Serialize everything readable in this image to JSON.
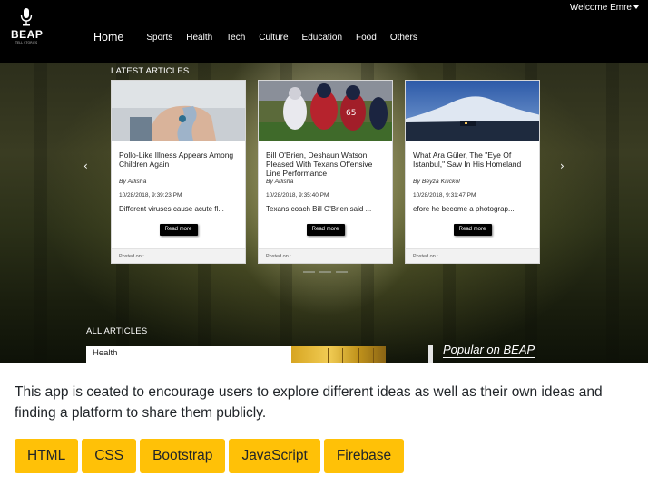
{
  "navbar": {
    "brand": "BEAP",
    "brand_tagline": "TELL STORIES",
    "links": [
      "Home",
      "Sports",
      "Health",
      "Tech",
      "Culture",
      "Education",
      "Food",
      "Others"
    ],
    "welcome": "Welcome Emre"
  },
  "carousel": {
    "heading": "LATEST ARTICLES",
    "read_more": "Read more",
    "posted_on": "Posted on :",
    "prev_icon": "chevron-left-icon",
    "next_icon": "chevron-right-icon",
    "articles": [
      {
        "title": "Pollo-Like Illness Appears Among Children Again",
        "author": "By Arlisha",
        "date": "10/28/2018, 9:39:23 PM",
        "excerpt": "Different viruses cause acute fl..."
      },
      {
        "title": "Bill O'Brien, Deshaun Watson Pleased With Texans Offensive Line Performance",
        "author": "By Arlisha",
        "date": "10/28/2018, 9:35:40 PM",
        "excerpt": "Texans coach Bill O'Brien said ..."
      },
      {
        "title": "What Ara Güler, The \"Eye Of Istanbul,\" Saw In His Homeland",
        "author": "By Beyza Kilickol",
        "date": "10/28/2018, 9:31:47 PM",
        "excerpt": "efore he become a photograp..."
      }
    ]
  },
  "all_articles": {
    "heading": "ALL ARTICLES",
    "first_category": "Health"
  },
  "sidebar": {
    "popular_heading": "Popular on BEAP"
  },
  "description": "This app is ceated to encourage users to explore different ideas as well as their own ideas and finding a platform to share them publicly.",
  "tech_tags": [
    "HTML",
    "CSS",
    "Bootstrap",
    "JavaScript",
    "Firebase"
  ],
  "colors": {
    "navbar": "#000000",
    "tag_background": "#ffc107",
    "text": "#212529"
  }
}
